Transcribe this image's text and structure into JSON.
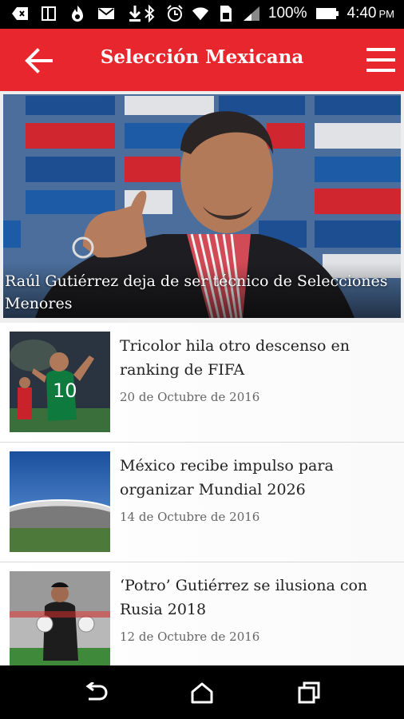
{
  "status_bar": {
    "battery_percent": "100%",
    "time": "4:40",
    "ampm": "PM",
    "icons_left": [
      "back-icon",
      "tablet-icon",
      "flame-icon",
      "mail-icon",
      "download-icon"
    ],
    "icons_right": [
      "bluetooth-icon",
      "alarm-icon",
      "wifi-icon",
      "sim-icon",
      "signal-icon",
      "battery-icon"
    ]
  },
  "app_bar": {
    "title": "Selección Mexicana",
    "color": "#e8262e"
  },
  "hero": {
    "caption": "Raúl Gutiérrez deja de ser técnico de Selecciones Menores"
  },
  "articles": [
    {
      "title": "Tricolor hila otro descenso en ranking de FIFA",
      "date": "20 de Octubre de 2016"
    },
    {
      "title": "México recibe impulso para organizar Mundial 2026",
      "date": "14 de Octubre de 2016"
    },
    {
      "title": "‘Potro’ Gutiérrez se ilusiona con Rusia 2018",
      "date": "12 de Octubre de 2016"
    }
  ],
  "nav_bar": {
    "icons": [
      "back-nav-icon",
      "home-icon",
      "recents-icon"
    ]
  }
}
